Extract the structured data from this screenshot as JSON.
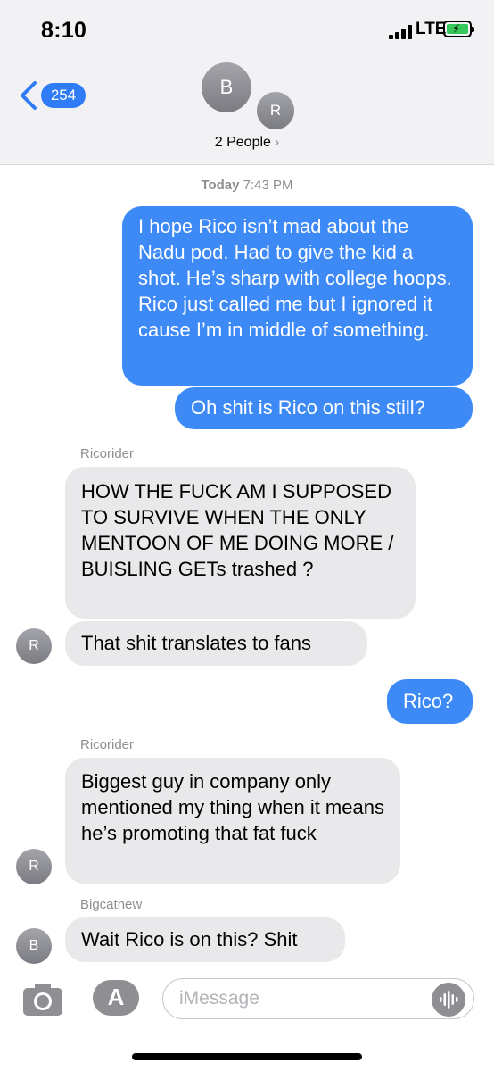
{
  "status_bar": {
    "time": "8:10",
    "network": "LTE"
  },
  "header": {
    "back_badge": "254",
    "avatar_primary": "B",
    "avatar_secondary": "R",
    "title": "2 People",
    "title_chevron": "›"
  },
  "conversation": {
    "timestamp_day": "Today",
    "timestamp_time": "7:43 PM",
    "messages": [
      {
        "type": "outgoing",
        "text": "I hope Rico isn’t mad about the Nadu pod.   Had to give the kid a shot.   He’s sharp with college hoops.  Rico just called me but I ignored it cause I’m in middle of something."
      },
      {
        "type": "outgoing",
        "text": "Oh shit is Rico on this still?"
      },
      {
        "type": "incoming",
        "sender": "Ricorider",
        "text": "HOW THE FUCK AM I SUPPOSED TO SURVIVE WHEN THE ONLY MENTOON OF ME DOING MORE / BUISLING GETs trashed ?"
      },
      {
        "type": "incoming",
        "avatar": "R",
        "text": "That shit translates to fans"
      },
      {
        "type": "outgoing",
        "text": "Rico?"
      },
      {
        "type": "incoming",
        "sender": "Ricorider",
        "avatar": "R",
        "text": "Biggest guy in company only mentioned my thing when it means he’s promoting that fat fuck"
      },
      {
        "type": "incoming",
        "sender": "Bigcatnew",
        "avatar": "B",
        "text": "Wait Rico is on this? Shit"
      }
    ]
  },
  "input_bar": {
    "placeholder": "iMessage",
    "camera_icon": "camera-icon",
    "apps_icon": "app-store-icon",
    "audio_icon": "waveform-icon"
  },
  "colors": {
    "outgoing_bubble": "#3d8af7",
    "incoming_bubble": "#e9e9eb",
    "header_bg": "#f2f2f4",
    "badge": "#2f7cf6",
    "secondary_text": "#8e8e93"
  }
}
